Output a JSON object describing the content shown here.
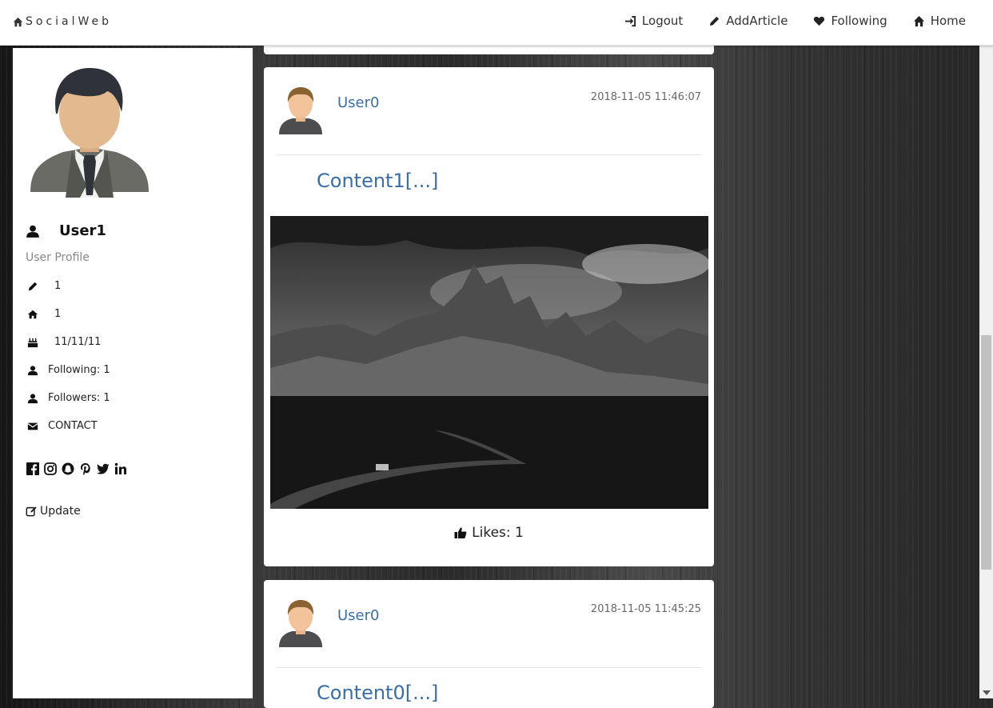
{
  "navbar": {
    "brand": "SocialWeb",
    "links": [
      {
        "label": "Logout",
        "icon": "logout-icon"
      },
      {
        "label": "AddArticle",
        "icon": "pencil-icon"
      },
      {
        "label": "Following",
        "icon": "heart-icon"
      },
      {
        "label": "Home",
        "icon": "home-icon"
      }
    ]
  },
  "sidebar": {
    "username": "User1",
    "subtitle": "User Profile",
    "info": [
      {
        "icon": "pencil-icon",
        "value": "1"
      },
      {
        "icon": "home-icon",
        "value": "1"
      },
      {
        "icon": "birthday-cake-icon",
        "value": "11/11/11"
      },
      {
        "icon": "user-icon",
        "value": "Following: 1"
      },
      {
        "icon": "user-icon",
        "value": "Followers: 1"
      },
      {
        "icon": "envelope-icon",
        "value": "CONTACT"
      }
    ],
    "social": [
      "facebook-icon",
      "instagram-icon",
      "snapchat-icon",
      "pinterest-icon",
      "twitter-icon",
      "linkedin-icon"
    ],
    "update_label": "Update"
  },
  "posts": [
    {
      "user": "User0",
      "timestamp": "2018-11-05 11:46:07",
      "content": "Content1[...]",
      "likes": "Likes: 1"
    },
    {
      "user": "User0",
      "timestamp": "2018-11-05 11:45:25",
      "content": "Content0[...]"
    }
  ],
  "colors": {
    "link": "#3b6ea5",
    "background": "#2a2a2a"
  }
}
